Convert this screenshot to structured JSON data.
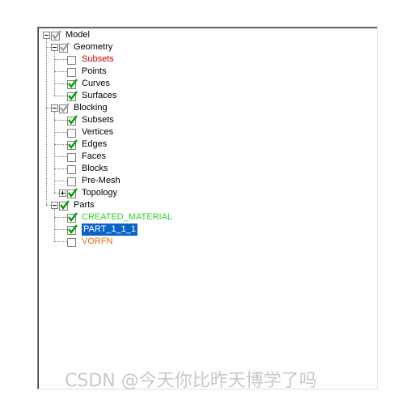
{
  "tree": {
    "nodes": [
      {
        "label": "Model",
        "level": 0,
        "expander": "minus",
        "check": "gray",
        "color": "black"
      },
      {
        "label": "Geometry",
        "level": 1,
        "expander": "minus",
        "check": "gray",
        "color": "black"
      },
      {
        "label": "Subsets",
        "level": 2,
        "expander": "none",
        "check": "empty",
        "color": "red"
      },
      {
        "label": "Points",
        "level": 2,
        "expander": "none",
        "check": "empty",
        "color": "black"
      },
      {
        "label": "Curves",
        "level": 2,
        "expander": "none",
        "check": "checked",
        "color": "black"
      },
      {
        "label": "Surfaces",
        "level": 2,
        "expander": "none",
        "check": "checked",
        "color": "black"
      },
      {
        "label": "Blocking",
        "level": 1,
        "expander": "minus",
        "check": "gray",
        "color": "black"
      },
      {
        "label": "Subsets",
        "level": 2,
        "expander": "none",
        "check": "checked",
        "color": "black"
      },
      {
        "label": "Vertices",
        "level": 2,
        "expander": "none",
        "check": "empty",
        "color": "black"
      },
      {
        "label": "Edges",
        "level": 2,
        "expander": "none",
        "check": "checked",
        "color": "black"
      },
      {
        "label": "Faces",
        "level": 2,
        "expander": "none",
        "check": "empty",
        "color": "black"
      },
      {
        "label": "Blocks",
        "level": 2,
        "expander": "none",
        "check": "empty",
        "color": "black"
      },
      {
        "label": "Pre-Mesh",
        "level": 2,
        "expander": "none",
        "check": "empty",
        "color": "black"
      },
      {
        "label": "Topology",
        "level": 2,
        "expander": "plus",
        "check": "checked",
        "color": "black"
      },
      {
        "label": "Parts",
        "level": 1,
        "expander": "minus",
        "check": "checked",
        "color": "black"
      },
      {
        "label": "CREATED_MATERIAL",
        "level": 2,
        "expander": "none",
        "check": "checked",
        "color": "green"
      },
      {
        "label": "PART_1_1_1",
        "level": 2,
        "expander": "none",
        "check": "checked",
        "color": "selected"
      },
      {
        "label": "VORFN",
        "level": 2,
        "expander": "none",
        "check": "empty",
        "color": "orange"
      }
    ]
  },
  "colors": {
    "check_green": "#00a000",
    "check_gray": "#a0a0a0",
    "selection": "#0a64c8"
  },
  "watermark": "CSDN @今天你比昨天博学了吗"
}
